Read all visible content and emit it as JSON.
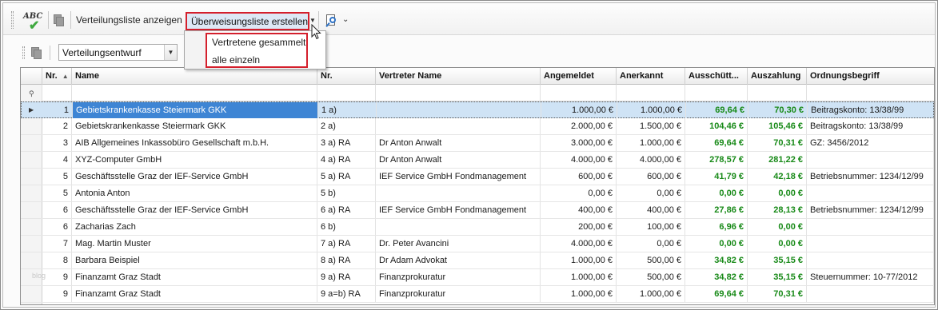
{
  "toolbar": {
    "spellcheck_icon_text": "ABC",
    "show_distribution_label": "Verteilungsliste anzeigen",
    "create_transfer_label": "Überweisungsliste erstellen"
  },
  "menu": {
    "items": [
      "Vertretene gesammelt",
      "alle einzeln"
    ]
  },
  "filter": {
    "selected": "Verteilungsentwurf"
  },
  "grid": {
    "columns": [
      "Nr.",
      "Name",
      "Nr.",
      "Vertreter Name",
      "Angemeldet",
      "Anerkannt",
      "Ausschütt...",
      "Auszahlung",
      "Ordnungsbegriff"
    ],
    "sort_column": "Nr.",
    "sort_direction": "ascending",
    "selected_row": 0,
    "rows": [
      {
        "nr": "1",
        "name": "Gebietskrankenkasse Steiermark GKK",
        "nr2": "1 a)",
        "vertreter": "",
        "angemeldet": "1.000,00 €",
        "anerkannt": "1.000,00 €",
        "ausschuett": "69,64 €",
        "auszahlung": "70,30 €",
        "ordnung": "Beitragskonto: 13/38/99"
      },
      {
        "nr": "2",
        "name": "Gebietskrankenkasse Steiermark GKK",
        "nr2": "2 a)",
        "vertreter": "",
        "angemeldet": "2.000,00 €",
        "anerkannt": "1.500,00 €",
        "ausschuett": "104,46 €",
        "auszahlung": "105,46 €",
        "ordnung": "Beitragskonto: 13/38/99"
      },
      {
        "nr": "3",
        "name": "AIB Allgemeines Inkassobüro Gesellschaft m.b.H.",
        "nr2": "3 a) RA",
        "vertreter": "Dr Anton Anwalt",
        "angemeldet": "3.000,00 €",
        "anerkannt": "1.000,00 €",
        "ausschuett": "69,64 €",
        "auszahlung": "70,31 €",
        "ordnung": "GZ: 3456/2012"
      },
      {
        "nr": "4",
        "name": "XYZ-Computer GmbH",
        "nr2": "4 a) RA",
        "vertreter": "Dr Anton Anwalt",
        "angemeldet": "4.000,00 €",
        "anerkannt": "4.000,00 €",
        "ausschuett": "278,57 €",
        "auszahlung": "281,22 €",
        "ordnung": ""
      },
      {
        "nr": "5",
        "name": "Geschäftsstelle Graz der IEF-Service GmbH",
        "nr2": "5 a) RA",
        "vertreter": "IEF Service GmbH Fondmanagement",
        "angemeldet": "600,00 €",
        "anerkannt": "600,00 €",
        "ausschuett": "41,79 €",
        "auszahlung": "42,18 €",
        "ordnung": "Betriebsnummer: 1234/12/99"
      },
      {
        "nr": "5",
        "name": "Antonia Anton",
        "nr2": "5 b)",
        "vertreter": "",
        "angemeldet": "0,00 €",
        "anerkannt": "0,00 €",
        "ausschuett": "0,00 €",
        "auszahlung": "0,00 €",
        "ordnung": ""
      },
      {
        "nr": "6",
        "name": "Geschäftsstelle Graz der IEF-Service GmbH",
        "nr2": "6 a) RA",
        "vertreter": "IEF Service GmbH Fondmanagement",
        "angemeldet": "400,00 €",
        "anerkannt": "400,00 €",
        "ausschuett": "27,86 €",
        "auszahlung": "28,13 €",
        "ordnung": "Betriebsnummer: 1234/12/99"
      },
      {
        "nr": "6",
        "name": "Zacharias Zach",
        "nr2": "6 b)",
        "vertreter": "",
        "angemeldet": "200,00 €",
        "anerkannt": "100,00 €",
        "ausschuett": "6,96 €",
        "auszahlung": "0,00 €",
        "ordnung": ""
      },
      {
        "nr": "7",
        "name": "Mag. Martin Muster",
        "nr2": "7 a) RA",
        "vertreter": "Dr. Peter Avancini",
        "angemeldet": "4.000,00 €",
        "anerkannt": "0,00 €",
        "ausschuett": "0,00 €",
        "auszahlung": "0,00 €",
        "ordnung": ""
      },
      {
        "nr": "8",
        "name": "Barbara Beispiel",
        "nr2": "8 a) RA",
        "vertreter": "Dr Adam Advokat",
        "angemeldet": "1.000,00 €",
        "anerkannt": "500,00 €",
        "ausschuett": "34,82 €",
        "auszahlung": "35,15 €",
        "ordnung": ""
      },
      {
        "nr": "9",
        "name": "Finanzamt Graz Stadt",
        "nr2": "9 a) RA",
        "vertreter": "Finanzprokuratur",
        "angemeldet": "1.000,00 €",
        "anerkannt": "500,00 €",
        "ausschuett": "34,82 €",
        "auszahlung": "35,15 €",
        "ordnung": "Steuernummer: 10-77/2012"
      },
      {
        "nr": "9",
        "name": "Finanzamt Graz Stadt",
        "nr2": "9 a=b) RA",
        "vertreter": "Finanzprokuratur",
        "angemeldet": "1.000,00 €",
        "anerkannt": "1.000,00 €",
        "ausschuett": "69,64 €",
        "auszahlung": "70,31 €",
        "ordnung": ""
      }
    ]
  },
  "watermark": "blog",
  "colors": {
    "highlight_border": "#d41f2c",
    "selection_blue": "#3e85d4",
    "positive_green": "#188a18"
  }
}
